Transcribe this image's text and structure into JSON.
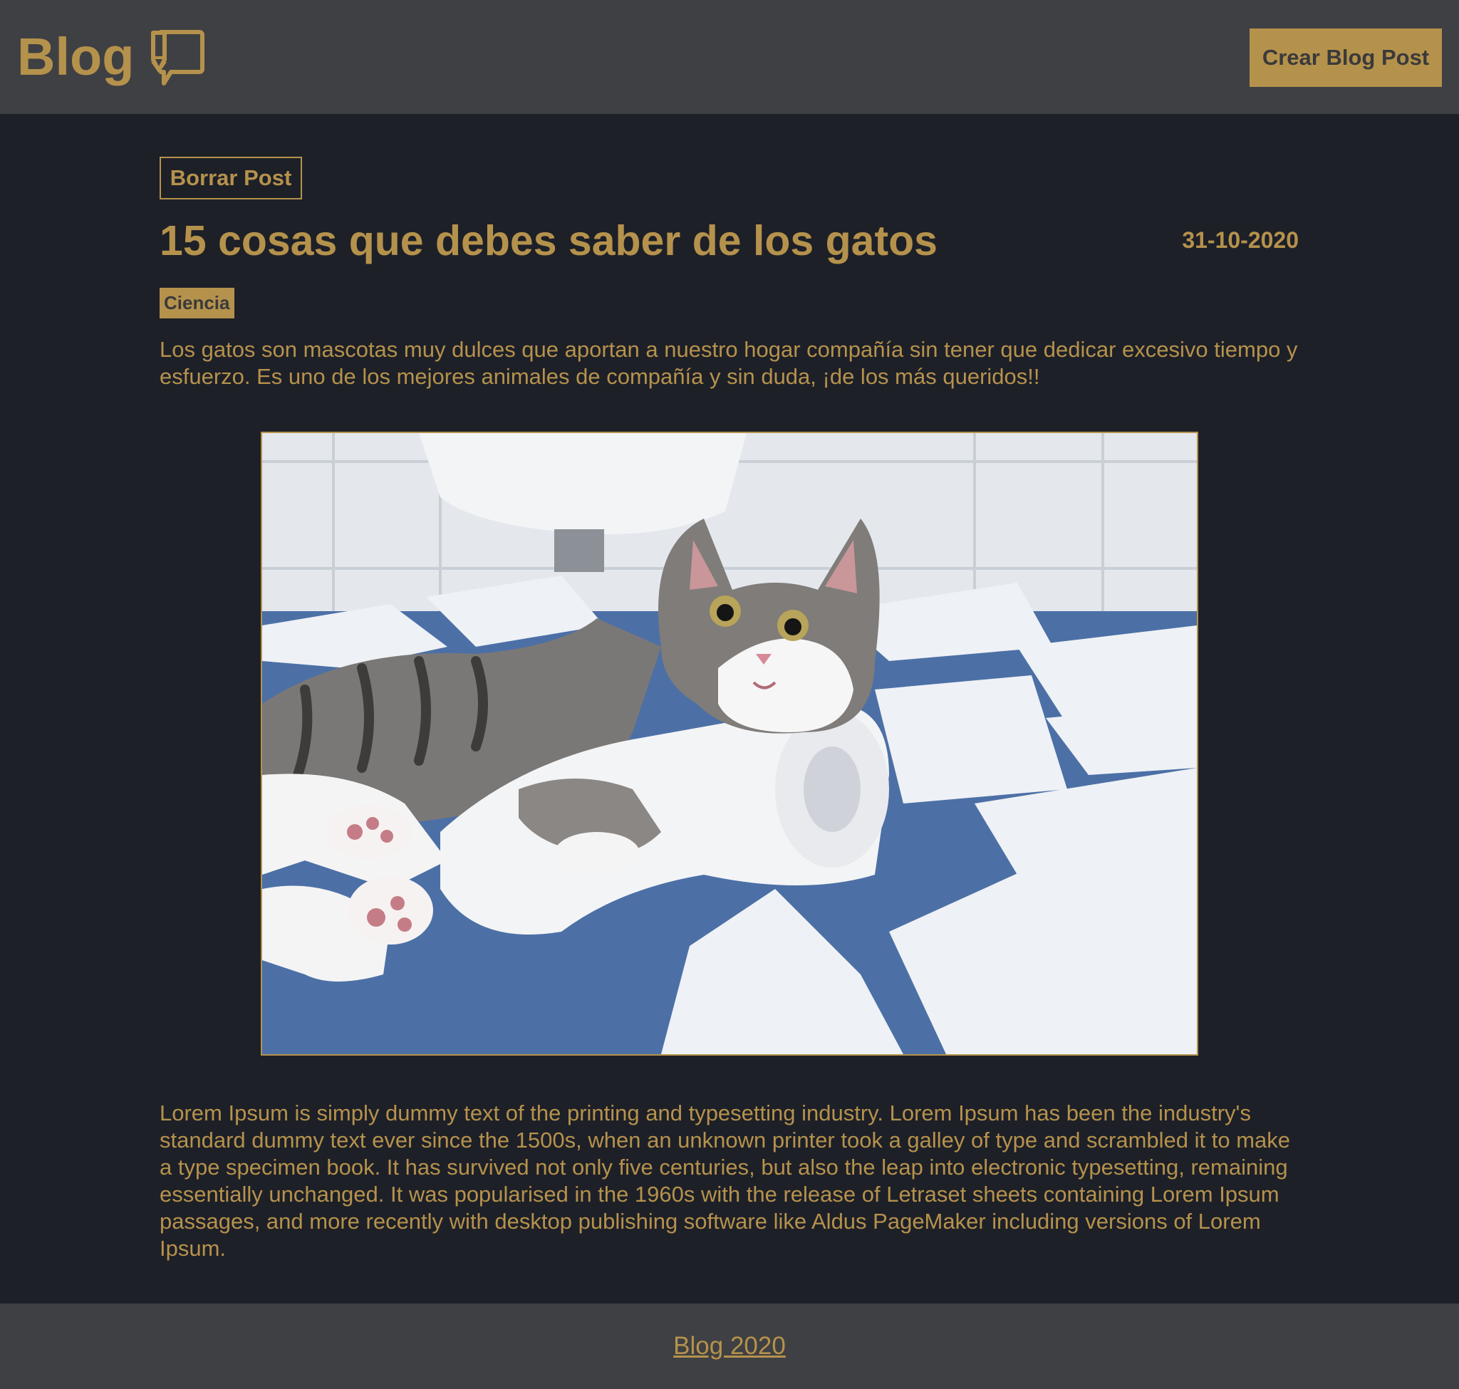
{
  "header": {
    "brand": "Blog",
    "brand_icon": "chat-bubble-pen-icon",
    "create_button": "Crear Blog Post"
  },
  "post": {
    "delete_button": "Borrar Post",
    "title": "15 cosas que debes saber de los gatos",
    "date": "31-10-2020",
    "category": "Ciencia",
    "intro": "Los gatos son mascotas muy dulces que aportan a nuestro hogar compañía sin tener que dedicar excesivo tiempo y esfuerzo. Es uno de los mejores animales de compañía y sin duda, ¡de los más queridos!!",
    "image_subject": "cat-in-toilet-paper-photo",
    "body": "Lorem Ipsum is simply dummy text of the printing and typesetting industry. Lorem Ipsum has been the industry's standard dummy text ever since the 1500s, when an unknown printer took a galley of type and scrambled it to make a type specimen book. It has survived not only five centuries, but also the leap into electronic typesetting, remaining essentially unchanged. It was popularised in the 1960s with the release of Letraset sheets containing Lorem Ipsum passages, and more recently with desktop publishing software like Aldus PageMaker including versions of Lorem Ipsum."
  },
  "footer": {
    "link": "Blog 2020"
  },
  "colors": {
    "accent": "#b5924c",
    "header_bg": "#3f4043",
    "page_bg": "#1e2028",
    "button_text": "#3a3a3a"
  }
}
